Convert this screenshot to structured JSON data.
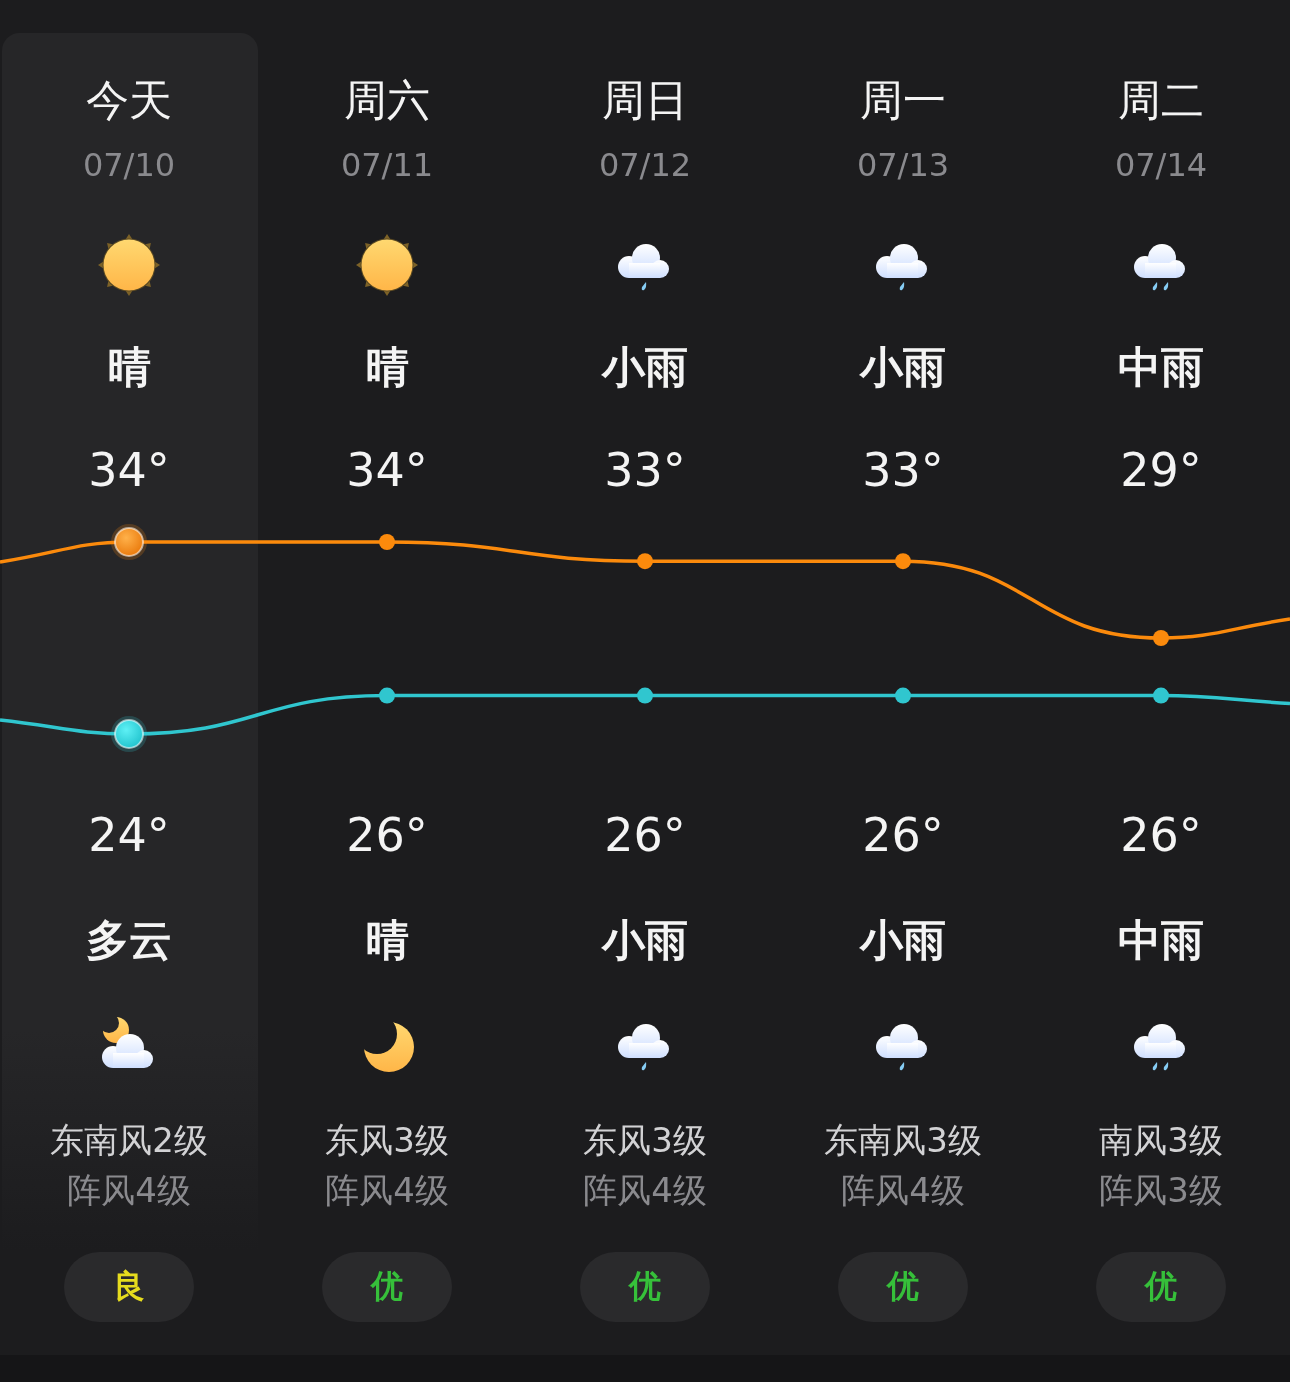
{
  "days": [
    {
      "name": "今天",
      "date": "07/10",
      "selected": true,
      "day": {
        "kind": "sun",
        "condition": "晴"
      },
      "night": {
        "condition": "多云",
        "kind": "cloudmoon"
      },
      "wind": "东南风2级",
      "gust": "阵风4级",
      "aqi": {
        "label": "良",
        "color": "#e6dc1e"
      }
    },
    {
      "name": "周六",
      "date": "07/11",
      "selected": false,
      "day": {
        "kind": "sun",
        "condition": "晴"
      },
      "night": {
        "condition": "晴",
        "kind": "moon"
      },
      "wind": "东风3级",
      "gust": "阵风4级",
      "aqi": {
        "label": "优",
        "color": "#36c03a"
      }
    },
    {
      "name": "周日",
      "date": "07/12",
      "selected": false,
      "day": {
        "kind": "drizzle",
        "condition": "小雨"
      },
      "night": {
        "condition": "小雨",
        "kind": "drizzle"
      },
      "wind": "东风3级",
      "gust": "阵风4级",
      "aqi": {
        "label": "优",
        "color": "#36c03a"
      }
    },
    {
      "name": "周一",
      "date": "07/13",
      "selected": false,
      "day": {
        "kind": "drizzle",
        "condition": "小雨"
      },
      "night": {
        "condition": "小雨",
        "kind": "drizzle"
      },
      "wind": "东南风3级",
      "gust": "阵风4级",
      "aqi": {
        "label": "优",
        "color": "#36c03a"
      }
    },
    {
      "name": "周二",
      "date": "07/14",
      "selected": false,
      "day": {
        "kind": "rain",
        "condition": "中雨"
      },
      "night": {
        "condition": "中雨",
        "kind": "rain"
      },
      "wind": "南风3级",
      "gust": "阵风3级",
      "aqi": {
        "label": "优",
        "color": "#36c03a"
      }
    }
  ],
  "chart_data": {
    "type": "line",
    "categories": [
      null,
      null,
      null,
      null,
      null
    ],
    "series": [
      {
        "color": "#fb8a0c",
        "marker": true,
        "values": [
          34,
          34,
          33,
          33,
          29
        ],
        "value_labels": [
          "34°",
          "34°",
          "33°",
          "33°",
          "29°"
        ]
      },
      {
        "color": "#30c6cf",
        "marker": true,
        "values": [
          24,
          26,
          26,
          26,
          26
        ],
        "value_labels": [
          "24°",
          "26°",
          "26°",
          "26°",
          "26°"
        ]
      }
    ]
  }
}
